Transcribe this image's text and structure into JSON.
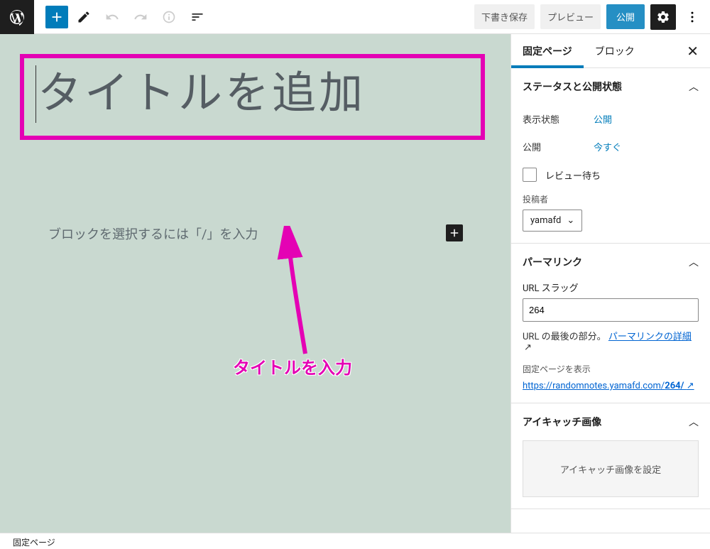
{
  "toolbar": {
    "save_draft": "下書き保存",
    "preview": "プレビュー",
    "publish": "公開"
  },
  "editor": {
    "title_placeholder": "タイトルを追加",
    "block_hint": "ブロックを選択するには「/」を入力",
    "annotation": "タイトルを入力"
  },
  "sidebar": {
    "tabs": {
      "page": "固定ページ",
      "block": "ブロック"
    },
    "status": {
      "title": "ステータスと公開状態",
      "visibility_label": "表示状態",
      "visibility_value": "公開",
      "publish_label": "公開",
      "publish_value": "今すぐ",
      "pending_label": "レビュー待ち",
      "author_label": "投稿者",
      "author_value": "yamafd"
    },
    "permalink": {
      "title": "パーマリンク",
      "slug_label": "URL スラッグ",
      "slug_value": "264",
      "help_prefix": "URL の最後の部分。",
      "help_link": "パーマリンクの詳細",
      "view_label": "固定ページを表示",
      "url_prefix": "https://randomnotes.yamafd.com/",
      "url_suffix": "264/"
    },
    "featured": {
      "title": "アイキャッチ画像",
      "button": "アイキャッチ画像を設定"
    }
  },
  "footer": {
    "breadcrumb": "固定ページ"
  }
}
